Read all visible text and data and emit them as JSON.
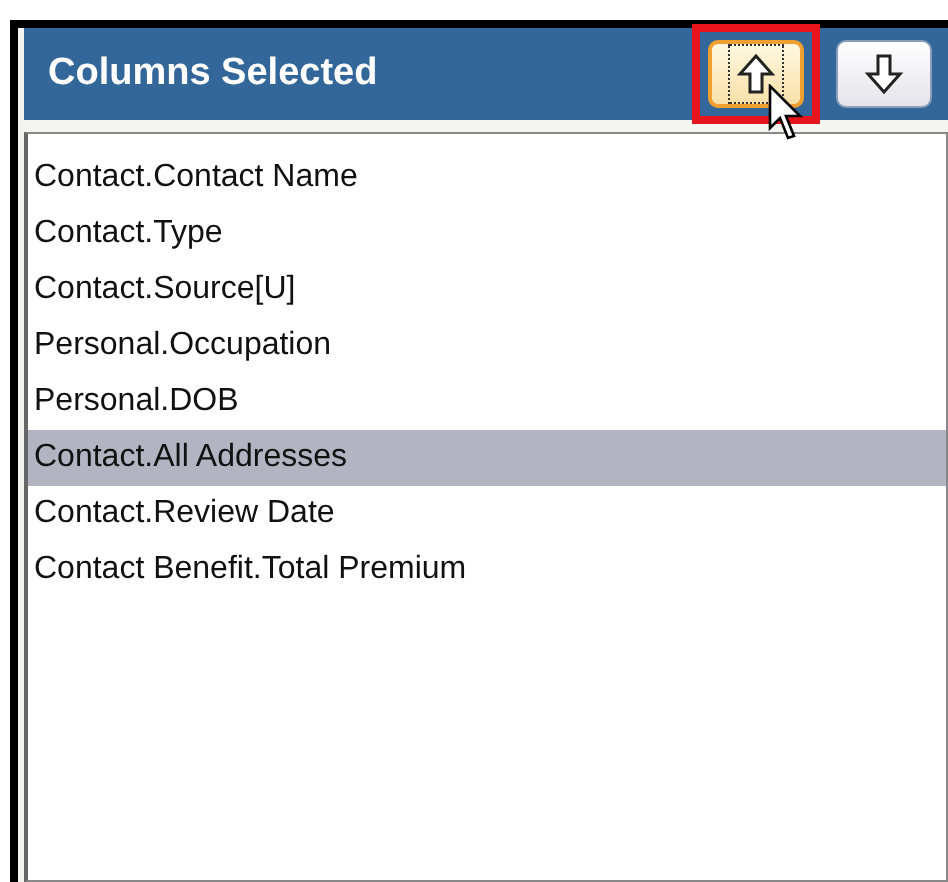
{
  "panel": {
    "title": "Columns Selected"
  },
  "buttons": [
    {
      "kind": "up",
      "focused": true,
      "highlighted": true,
      "hovered": true
    },
    {
      "kind": "down",
      "focused": false,
      "highlighted": false,
      "hovered": false
    }
  ],
  "columns": [
    {
      "label": "Contact.Contact Name",
      "selected": false
    },
    {
      "label": "Contact.Type",
      "selected": false
    },
    {
      "label": "Contact.Source[U]",
      "selected": false
    },
    {
      "label": "Personal.Occupation",
      "selected": false
    },
    {
      "label": "Personal.DOB",
      "selected": false
    },
    {
      "label": "Contact.All Addresses",
      "selected": true
    },
    {
      "label": "Contact.Review Date",
      "selected": false
    },
    {
      "label": "Contact Benefit.Total Premium",
      "selected": false
    }
  ]
}
